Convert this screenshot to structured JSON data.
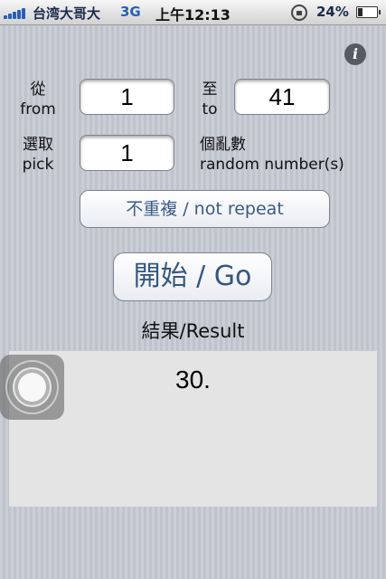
{
  "status_bar": {
    "carrier": "台湾大哥大",
    "network": "3G",
    "time": "上午12:13",
    "battery_percent": "24%",
    "battery_level": 0.24
  },
  "info_icon": "i",
  "from": {
    "label_zh": "從",
    "label_en": "from",
    "value": "1"
  },
  "to": {
    "label_zh": "至",
    "label_en": "to",
    "value": "41"
  },
  "pick": {
    "label_zh": "選取",
    "label_en": "pick",
    "value": "1"
  },
  "random_count": {
    "label_zh": "個亂數",
    "label_en": "random number(s)"
  },
  "repeat_button": "不重複 / not repeat",
  "go_button": "開始 / Go",
  "result": {
    "title": "結果/Result",
    "value": "30."
  }
}
